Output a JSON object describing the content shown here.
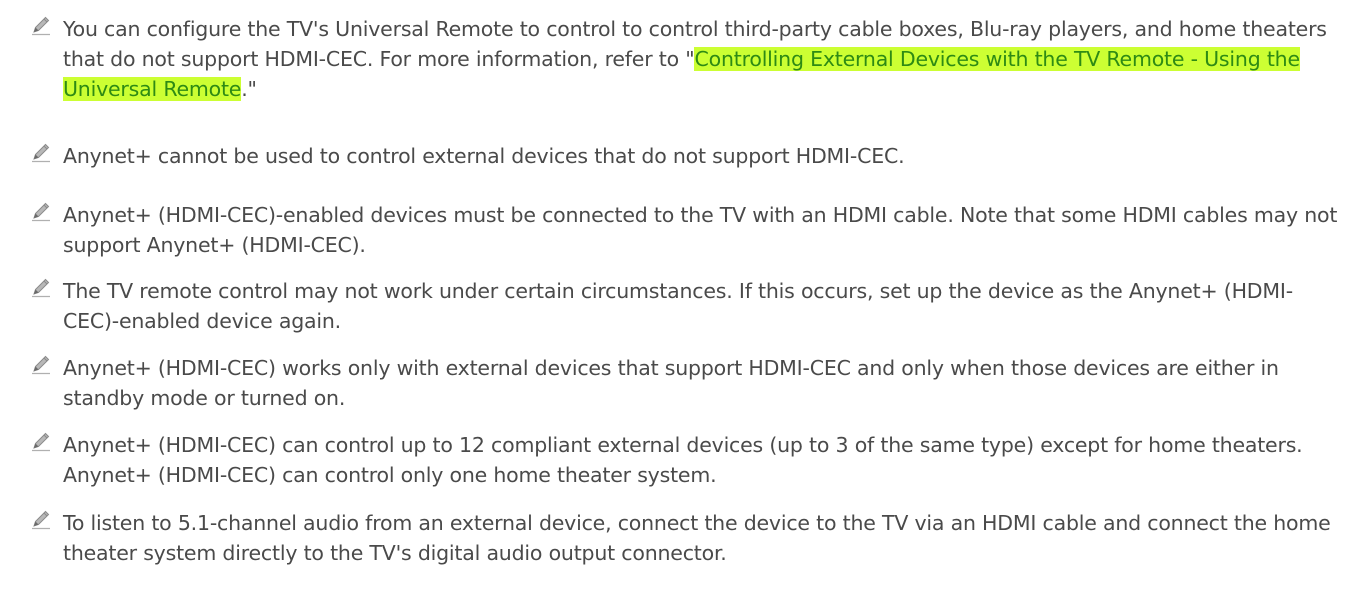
{
  "icon": "pencil-note-icon",
  "notes": [
    {
      "before": "You can configure the TV's Universal Remote to control to control third-party cable boxes, Blu-ray players, and home theaters that do not support HDMI-CEC. For more information, refer to \"",
      "link": "Controlling External Devices with the TV Remote - Using the Universal Remote",
      "after": ".\""
    },
    {
      "text": "Anynet+ cannot be used to control external devices that do not support HDMI-CEC."
    },
    {
      "text": "Anynet+ (HDMI-CEC)-enabled devices must be connected to the TV with an HDMI cable. Note that some HDMI cables may not support Anynet+ (HDMI-CEC)."
    },
    {
      "text": "The TV remote control may not work under certain circumstances. If this occurs, set up the device as the Anynet+ (HDMI-CEC)-enabled device again."
    },
    {
      "text": "Anynet+ (HDMI-CEC) works only with external devices that support HDMI-CEC and only when those devices are either in standby mode or turned on."
    },
    {
      "text": "Anynet+ (HDMI-CEC) can control up to 12 compliant external devices (up to 3 of the same type) except for home theaters. Anynet+ (HDMI-CEC) can control only one home theater system."
    },
    {
      "text": "To listen to 5.1-channel audio from an external device, connect the device to the TV via an HDMI cable and connect the home theater system directly to the TV's digital audio output connector."
    }
  ]
}
